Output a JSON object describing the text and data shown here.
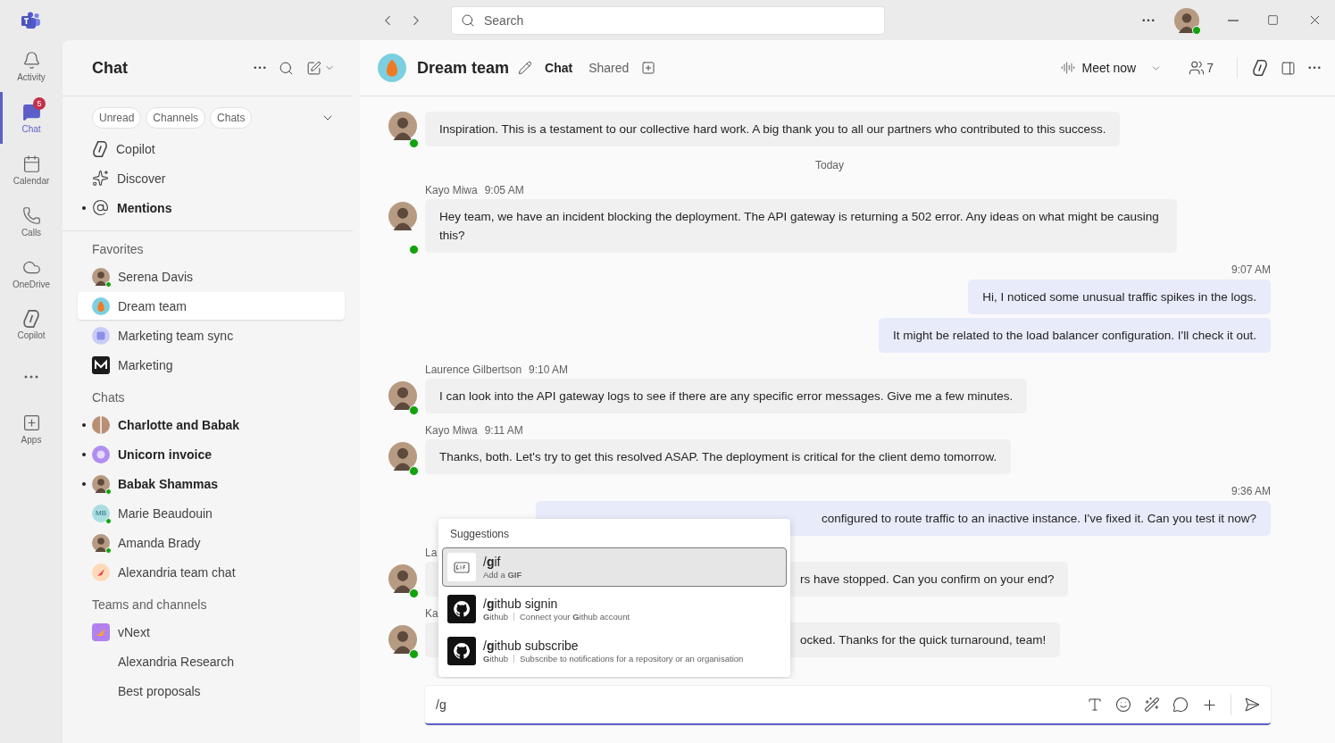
{
  "title_bar": {
    "search": {
      "placeholder": "Search"
    }
  },
  "app_bar": [
    {
      "kind": "activity",
      "label": "Activity",
      "selected": false
    },
    {
      "kind": "chat",
      "label": "Chat",
      "selected": true,
      "badge": "5"
    },
    {
      "kind": "calendar",
      "label": "Calendar",
      "selected": false
    },
    {
      "kind": "calls",
      "label": "Calls",
      "selected": false
    },
    {
      "kind": "onedrive",
      "label": "OneDrive",
      "selected": false
    },
    {
      "kind": "copilot",
      "label": "Copilot",
      "selected": false
    },
    {
      "kind": "more",
      "selected": false
    },
    {
      "kind": "apps",
      "label": "Apps",
      "selected": false
    }
  ],
  "chat_list": {
    "title": "Chat",
    "filters": [
      {
        "label": "Unread",
        "selected": false
      },
      {
        "label": "Channels",
        "selected": false
      },
      {
        "label": "Chats",
        "selected": false
      }
    ],
    "pinned": [
      {
        "kind": "copilot",
        "name": "Copilot",
        "unread": false
      },
      {
        "kind": "discover",
        "name": "Discover",
        "unread": false
      },
      {
        "kind": "mention",
        "name": "Mentions",
        "unread": true
      }
    ],
    "sections": [
      {
        "title": "Favorites",
        "items": [
          {
            "kind": "person",
            "name": "Serena Davis",
            "unread": false,
            "online": true,
            "selected": false
          },
          {
            "kind": "fire",
            "name": "Dream team",
            "unread": false,
            "online": false,
            "selected": true
          },
          {
            "kind": "meeting",
            "name": "Marketing team sync",
            "unread": false,
            "online": false,
            "selected": false
          },
          {
            "kind": "logo",
            "name": "Marketing",
            "unread": false,
            "online": false,
            "selected": false
          }
        ]
      },
      {
        "title": "Chats",
        "items": [
          {
            "kind": "group",
            "name": "Charlotte and Babak",
            "unread": true,
            "online": false,
            "selected": false
          },
          {
            "kind": "unicorn",
            "name": "Unicorn invoice",
            "unread": true,
            "online": false,
            "selected": false
          },
          {
            "kind": "person",
            "name": "Babak Shammas",
            "unread": true,
            "online": true,
            "selected": false
          },
          {
            "kind": "initials",
            "initials": "MB",
            "name": "Marie Beaudouin",
            "unread": false,
            "online": true,
            "selected": false
          },
          {
            "kind": "person",
            "name": "Amanda Brady",
            "unread": false,
            "online": true,
            "selected": false
          },
          {
            "kind": "rocket",
            "name": "Alexandria team chat",
            "unread": false,
            "online": false,
            "selected": false
          }
        ]
      },
      {
        "title": "Teams and channels",
        "items": [
          {
            "kind": "team",
            "name": "vNext",
            "unread": false,
            "online": false,
            "selected": false,
            "children": [
              {
                "name": "Alexandria Research",
                "unread": false,
                "selected": false
              },
              {
                "name": "Best proposals",
                "unread": false,
                "selected": false
              }
            ]
          }
        ]
      }
    ]
  },
  "conversation": {
    "title": "Dream team",
    "tabs": [
      {
        "label": "Chat",
        "selected": true
      },
      {
        "label": "Shared",
        "selected": false
      }
    ],
    "meet_now": "Meet now",
    "participants": "7",
    "messages": [
      {
        "kind": "other",
        "online": true,
        "bubbles": [
          {
            "text": "Inspiration. This is a testament to our collective hard work. A big thank you to all our partners who contributed to this success.",
            "covered": false
          }
        ]
      },
      {
        "kind": "divider",
        "label": "Today"
      },
      {
        "kind": "other",
        "author": "Kayo Miwa",
        "time": "9:05 AM",
        "online": true,
        "bubbles": [
          {
            "text": "Hey team, we have an incident blocking the deployment. The API gateway is returning a 502 error. Any ideas on what might be causing this?",
            "covered": false
          }
        ]
      },
      {
        "kind": "self",
        "time": "9:07 AM",
        "bubbles": [
          {
            "text": "Hi, I noticed some unusual traffic spikes in the logs.",
            "covered": false
          },
          {
            "text": "It might be related to the load balancer configuration. I'll check it out.",
            "covered": false
          }
        ]
      },
      {
        "kind": "other",
        "author": "Laurence Gilbertson",
        "time": "9:10 AM",
        "online": true,
        "bubbles": [
          {
            "text": "I can look into the API gateway logs to see if there are any specific error messages. Give me a few minutes.",
            "covered": false
          }
        ]
      },
      {
        "kind": "other",
        "author": "Kayo Miwa",
        "time": "9:11 AM",
        "online": true,
        "bubbles": [
          {
            "text": "Thanks, both. Let's try to get this resolved ASAP. The deployment is critical for the client demo tomorrow.",
            "covered": false
          }
        ]
      },
      {
        "kind": "self",
        "time": "9:36 AM",
        "bubbles": [
          {
            "text": "configured to route traffic to an inactive instance. I've fixed it. Can you test it now?",
            "covered": true
          }
        ]
      },
      {
        "kind": "other",
        "author": "La",
        "online": true,
        "bubbles": [
          {
            "text": "rs have stopped. Can you confirm on your end?",
            "covered": true
          }
        ]
      },
      {
        "kind": "other",
        "author": "Ka",
        "online": true,
        "bubbles": [
          {
            "text": "ocked. Thanks for the quick turnaround, team!",
            "covered": true
          }
        ]
      }
    ],
    "suggestions": {
      "title": "Suggestions",
      "items": [
        {
          "kind": "gif",
          "command": "/**g**if",
          "description": "Add a **GIF**",
          "selected": true
        },
        {
          "kind": "github",
          "command": "/**g**ithub signin",
          "app": "**G**ithub",
          "description": "Connect your **G**ithub account",
          "selected": false
        },
        {
          "kind": "github",
          "command": "/**g**ithub subscribe",
          "app": "**G**ithub",
          "description": "Subscribe to notifications for a repository or an organisation",
          "selected": false
        }
      ]
    },
    "composer": {
      "value": "/g"
    }
  }
}
